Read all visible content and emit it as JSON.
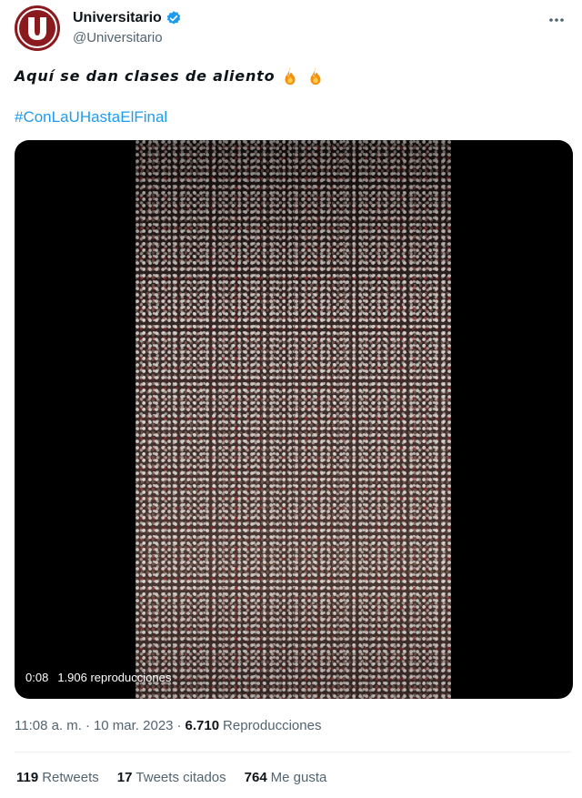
{
  "author": {
    "name": "Universitario",
    "handle": "@Universitario",
    "avatar_letter": "U",
    "verified": true
  },
  "tweet": {
    "text": "Aquí se dan clases de aliento",
    "emojis": [
      "fire-icon",
      "fire-icon"
    ],
    "hashtag": "#ConLaUHastaElFinal"
  },
  "video": {
    "duration": "0:08",
    "views": "1.906 reproducciones"
  },
  "meta": {
    "time": "11:08 a. m.",
    "separator1": "·",
    "date": "10 mar. 2023",
    "separator2": "·",
    "views_count": "6.710",
    "views_label": "Reproducciones"
  },
  "stats": {
    "retweets_count": "119",
    "retweets_label": "Retweets",
    "quotes_count": "17",
    "quotes_label": "Tweets citados",
    "likes_count": "764",
    "likes_label": "Me gusta"
  },
  "colors": {
    "accent": "#1d9bf0",
    "brand": "#8b1a1f",
    "secondary_text": "#536471"
  }
}
